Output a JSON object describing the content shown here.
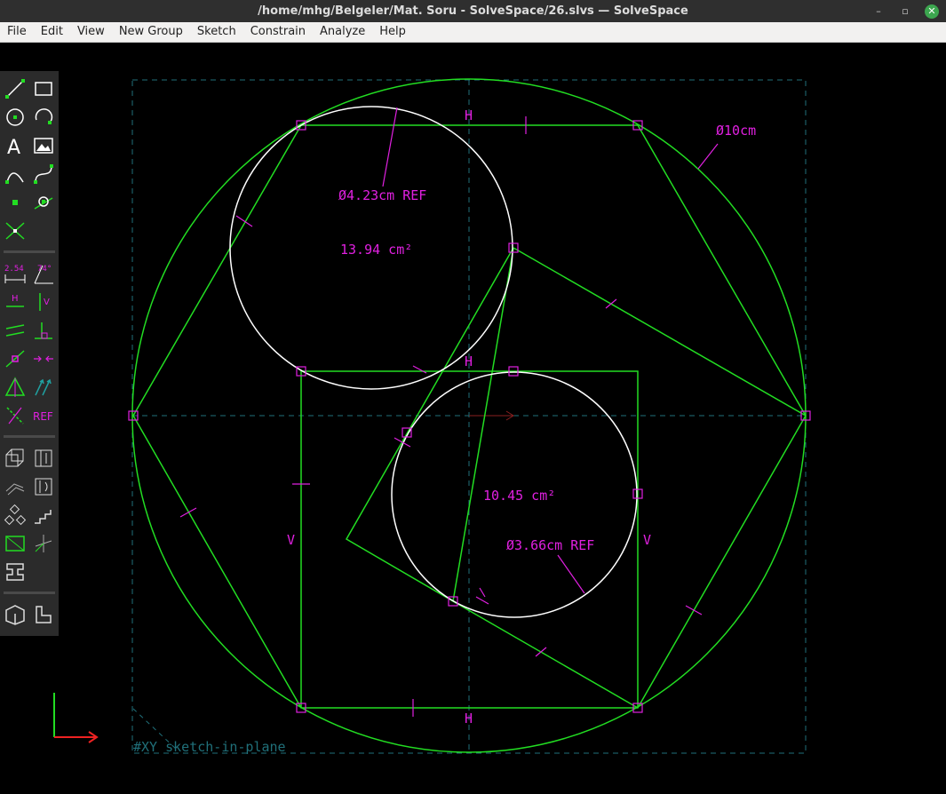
{
  "window": {
    "title": "/home/mhg/Belgeler/Mat. Soru - SolveSpace/26.slvs — SolveSpace",
    "minimize_glyph": "–",
    "restore_glyph": "▫",
    "close_glyph": "✕"
  },
  "menu": [
    "File",
    "Edit",
    "View",
    "New Group",
    "Sketch",
    "Constrain",
    "Analyze",
    "Help"
  ],
  "toolbar": {
    "dim_label": "2.54",
    "angle_label": "74°",
    "h_label": "H",
    "v_label": "V",
    "ref_label": "REF"
  },
  "sketch": {
    "big_circle_dim": "Ø10cm",
    "upper_circle_dim": "Ø4.23cm REF",
    "lower_circle_dim": "Ø3.66cm REF",
    "upper_area": "13.94 cm²",
    "lower_area": "10.45 cm²",
    "h_constraint": "H",
    "v_constraint": "V",
    "group_label": "#XY  sketch-in-plane"
  },
  "colors": {
    "entity": "#22dd22",
    "constraint": "#e020e0",
    "circle": "#ffffff",
    "workplane": "#20707a",
    "toolbar_bg": "#2b2b2b"
  }
}
